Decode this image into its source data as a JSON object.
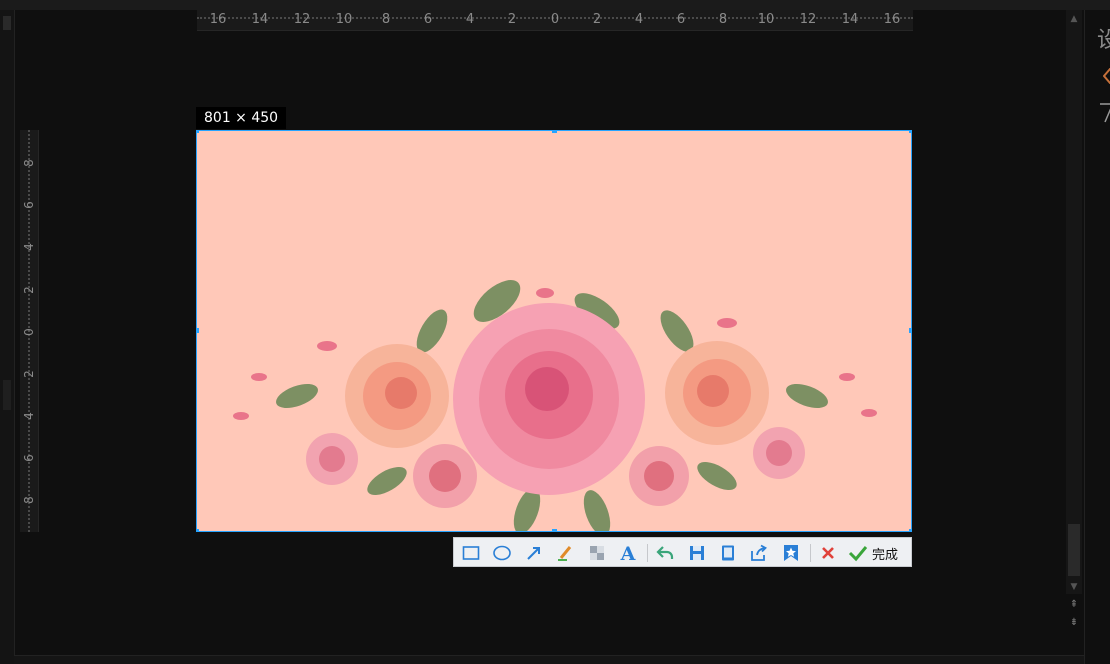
{
  "selection": {
    "size_label": "801 × 450",
    "accent_color": "#27a4ff",
    "image_bg": "#ffc8b8"
  },
  "ruler": {
    "horizontal_labels": [
      "16",
      "14",
      "12",
      "10",
      "8",
      "6",
      "4",
      "2",
      "0",
      "2",
      "4",
      "6",
      "8",
      "10",
      "12",
      "14",
      "16"
    ],
    "vertical_labels": [
      "8",
      "6",
      "4",
      "2",
      "0",
      "2",
      "4",
      "6",
      "8"
    ]
  },
  "toolbar": {
    "tools": [
      {
        "name": "rectangle-tool",
        "icon": "rectangle-icon"
      },
      {
        "name": "ellipse-tool",
        "icon": "ellipse-icon"
      },
      {
        "name": "arrow-tool",
        "icon": "arrow-icon"
      },
      {
        "name": "brush-tool",
        "icon": "brush-icon"
      },
      {
        "name": "mosaic-tool",
        "icon": "mosaic-icon"
      },
      {
        "name": "text-tool",
        "icon": "text-icon"
      },
      {
        "name": "undo-button",
        "icon": "undo-icon"
      },
      {
        "name": "save-button",
        "icon": "save-icon"
      },
      {
        "name": "pin-button",
        "icon": "pin-icon"
      },
      {
        "name": "share-button",
        "icon": "share-icon"
      },
      {
        "name": "collect-button",
        "icon": "star-bookmark-icon"
      },
      {
        "name": "cancel-button",
        "icon": "close-icon"
      }
    ],
    "done_label": "完成"
  },
  "right_panel": {
    "partial_char": "设"
  }
}
